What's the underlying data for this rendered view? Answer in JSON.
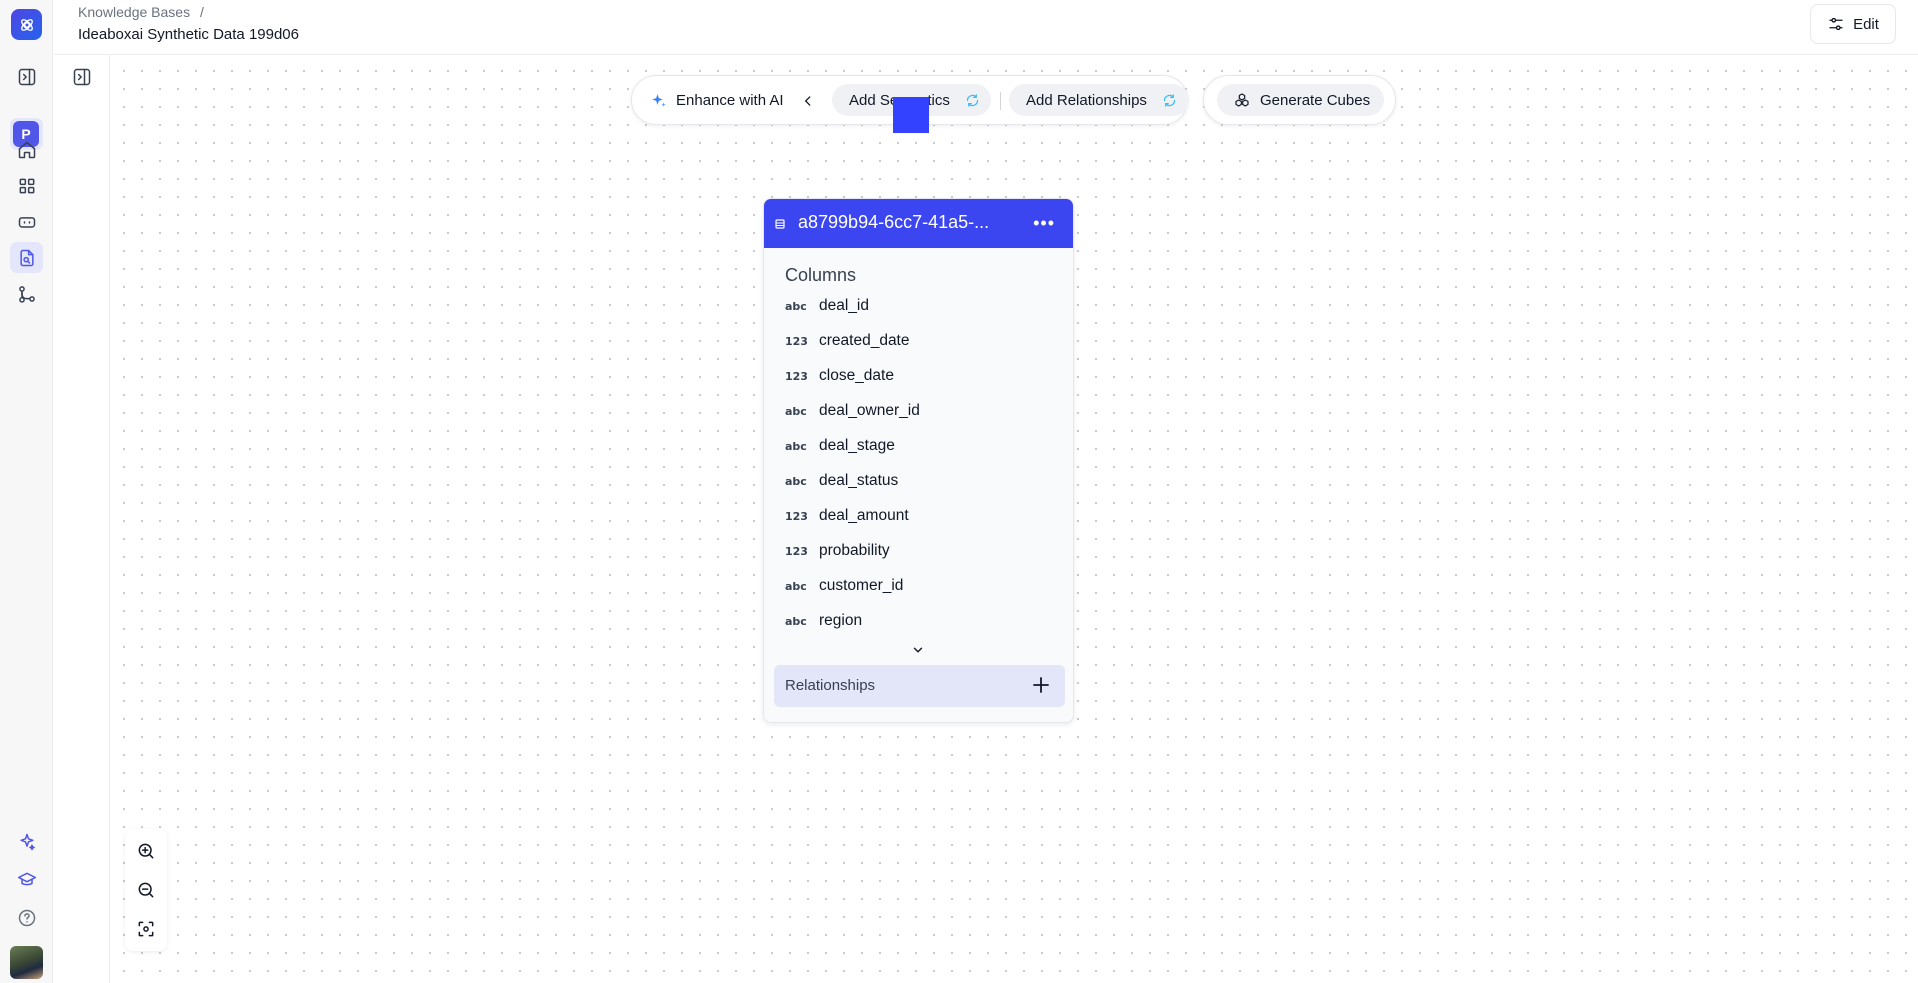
{
  "header": {
    "breadcrumb_root": "Knowledge Bases",
    "breadcrumb_sep": "/",
    "title": "Ideaboxai Synthetic Data 199d06",
    "edit_label": "Edit"
  },
  "sidebar": {
    "badge_letter": "P",
    "items": [
      {
        "icon": "sidebar-toggle-icon"
      },
      {
        "icon": "home-icon"
      },
      {
        "icon": "grid-icon"
      },
      {
        "icon": "bot-icon"
      },
      {
        "icon": "document-search-icon",
        "active": true
      },
      {
        "icon": "git-branch-icon"
      }
    ],
    "bottom_items": [
      {
        "icon": "sparkle-icon"
      },
      {
        "icon": "graduation-cap-icon"
      },
      {
        "icon": "help-icon"
      }
    ]
  },
  "toolbar": {
    "enhance_label": "Enhance with AI",
    "add_semantics_label": "Add Semantics",
    "add_relationships_label": "Add Relationships",
    "generate_cubes_label": "Generate Cubes"
  },
  "table_node": {
    "title": "a8799b94-6cc7-41a5-...",
    "columns_heading": "Columns",
    "columns": [
      {
        "type": "abc",
        "name": "deal_id"
      },
      {
        "type": "123",
        "name": "created_date"
      },
      {
        "type": "123",
        "name": "close_date"
      },
      {
        "type": "abc",
        "name": "deal_owner_id"
      },
      {
        "type": "abc",
        "name": "deal_stage"
      },
      {
        "type": "abc",
        "name": "deal_status"
      },
      {
        "type": "123",
        "name": "deal_amount"
      },
      {
        "type": "123",
        "name": "probability"
      },
      {
        "type": "abc",
        "name": "customer_id"
      },
      {
        "type": "abc",
        "name": "region"
      }
    ],
    "relationships_label": "Relationships"
  },
  "colors": {
    "accent": "#3b45f0",
    "spinner": "#38bdf8"
  }
}
